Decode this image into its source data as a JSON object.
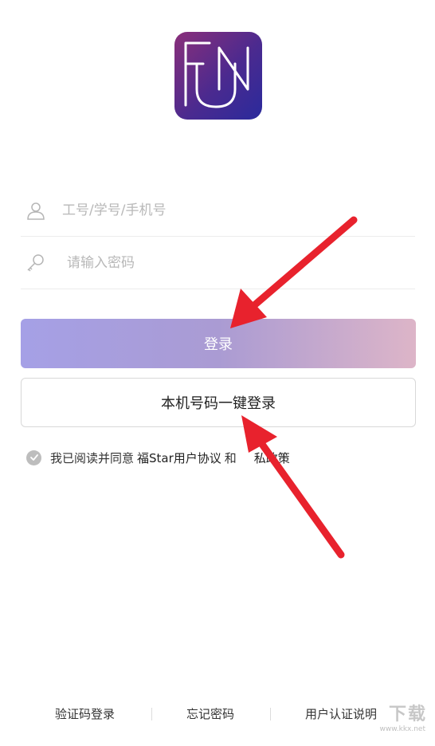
{
  "login": {
    "username_placeholder": "工号/学号/手机号",
    "password_placeholder": "请输入密码",
    "username_value": "",
    "password_value": "",
    "login_button": "登录",
    "onekey_button": "本机号码一键登录"
  },
  "agreement": {
    "prefix": "我已阅读并同意",
    "user_agreement": "福Star用户协议",
    "conjunction": "和",
    "privacy_policy": "私政策"
  },
  "footer": {
    "sms_login": "验证码登录",
    "forgot_password": "忘记密码",
    "auth_help": "用户认证说明"
  },
  "watermark": {
    "text": "下载",
    "url": "www.kkx.net"
  },
  "icons": {
    "logo": "fun-app-logo",
    "username": "user-icon",
    "password": "key-icon",
    "agreement_check": "check-circle-icon"
  },
  "colors": {
    "logo_gradient": [
      "#8a2f7a",
      "#2a2a9c"
    ],
    "login_gradient": [
      "#a5a0e6",
      "#ddb5c8"
    ],
    "arrow": "#e8222d"
  }
}
